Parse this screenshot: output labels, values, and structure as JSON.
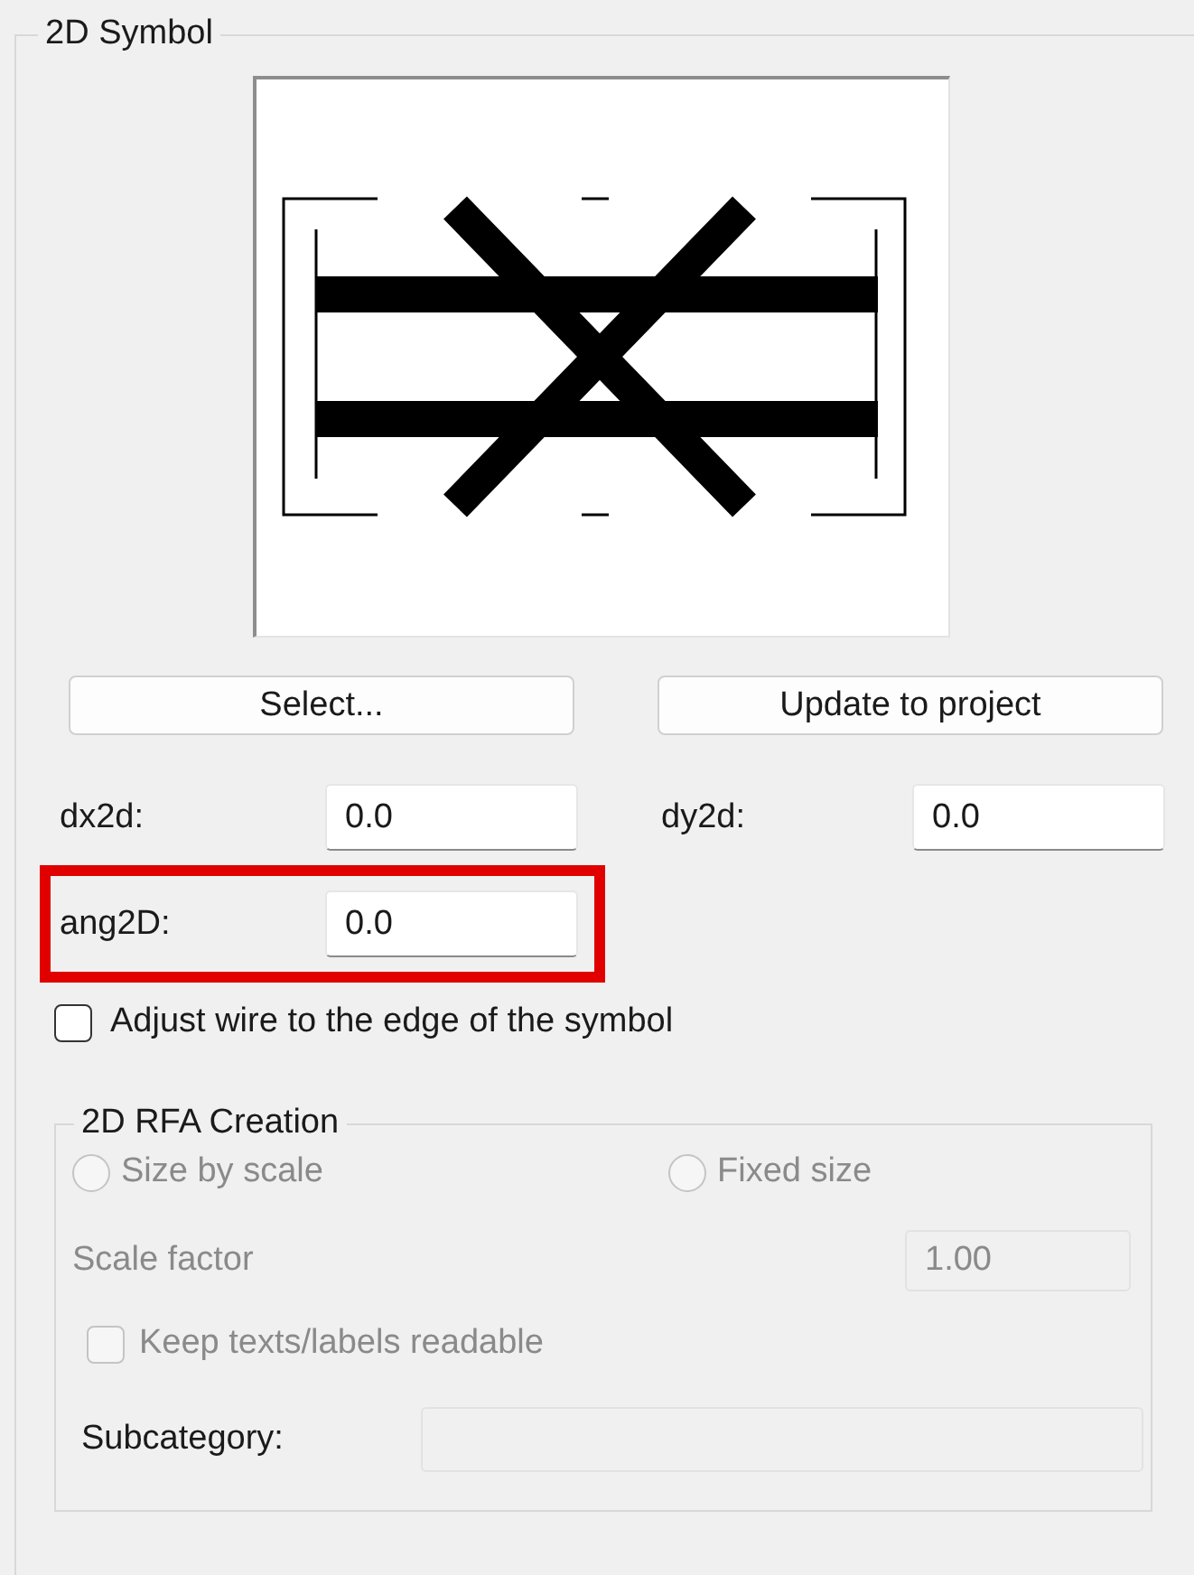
{
  "group": {
    "title": "2D Symbol"
  },
  "buttons": [
    {
      "label": "Select..."
    },
    {
      "label": "Update to project"
    }
  ],
  "fields": [
    {
      "label": "dx2d:",
      "value": "0.0",
      "highlighted": false
    },
    {
      "label": "dy2d:",
      "value": "0.0",
      "highlighted": false
    },
    {
      "label": "ang2D:",
      "value": "0.0",
      "highlighted": true
    }
  ],
  "adjust_wire": {
    "label": "Adjust wire to the edge of the symbol",
    "checked": false
  },
  "rfa": {
    "title": "2D RFA Creation",
    "options": [
      {
        "label": "Size by scale",
        "selected": false,
        "disabled": true
      },
      {
        "label": "Fixed size",
        "selected": false,
        "disabled": true
      }
    ],
    "scale_factor": {
      "label": "Scale factor",
      "value": "1.00",
      "disabled": true
    },
    "keep_readable": {
      "label": "Keep texts/labels readable",
      "checked": false,
      "disabled": true
    },
    "subcategory": {
      "label": "Subcategory:",
      "disabled": true
    }
  }
}
